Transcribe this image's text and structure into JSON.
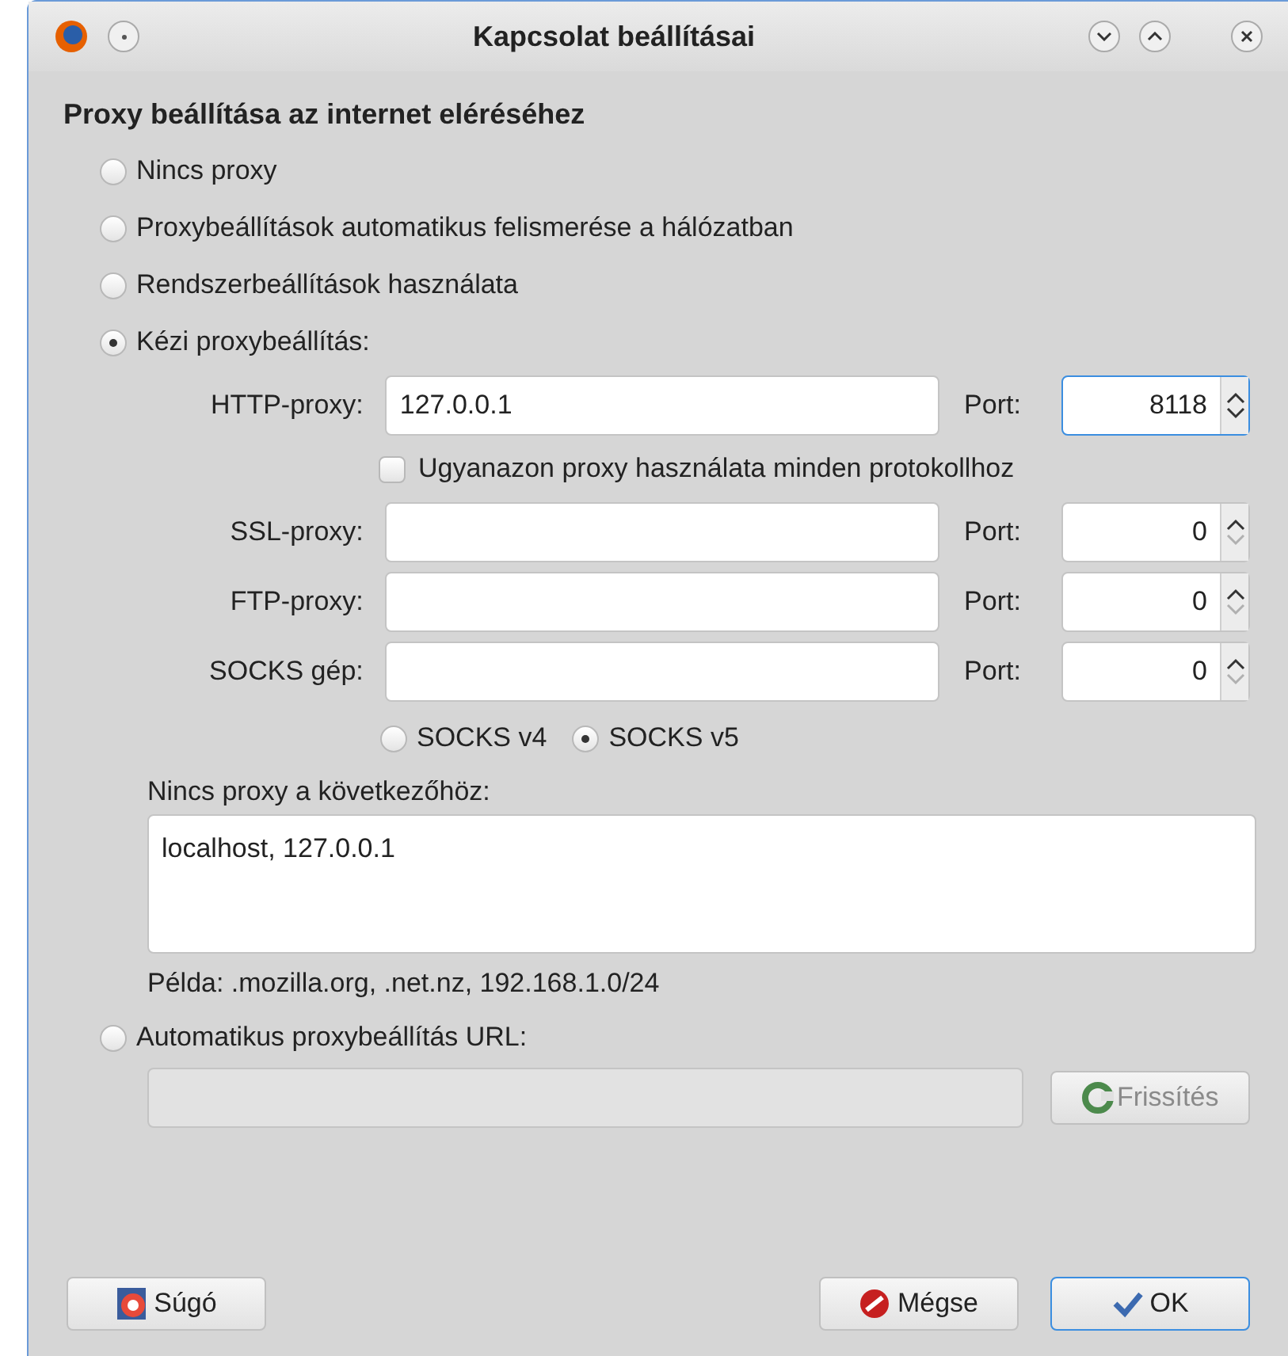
{
  "window": {
    "title": "Kapcsolat beállításai"
  },
  "heading": "Proxy beállítása az internet eléréséhez",
  "proxy_modes": [
    {
      "label": "Nincs proxy",
      "selected": false
    },
    {
      "label": "Proxybeállítások automatikus felismerése a hálózatban",
      "selected": false
    },
    {
      "label": "Rendszerbeállítások használata",
      "selected": false
    },
    {
      "label": "Kézi proxybeállítás:",
      "selected": true
    }
  ],
  "http": {
    "label": "HTTP-proxy:",
    "value": "127.0.0.1",
    "port_label": "Port:",
    "port": "8118",
    "focused": true,
    "at_minimum": false
  },
  "same_proxy": {
    "label": "Ugyanazon proxy használata minden protokollhoz",
    "checked": false
  },
  "other_rows": [
    {
      "label": "SSL-proxy:",
      "port_label": "Port:",
      "port": "0",
      "focused": false,
      "at_minimum": true
    },
    {
      "label": "FTP-proxy:",
      "port_label": "Port:",
      "port": "0",
      "focused": false,
      "at_minimum": true
    },
    {
      "label": "SOCKS gép:",
      "port_label": "Port:",
      "port": "0",
      "focused": false,
      "at_minimum": true
    }
  ],
  "socks_versions": [
    {
      "label": "SOCKS v4",
      "selected": false
    },
    {
      "label": "SOCKS v5",
      "selected": true
    }
  ],
  "no_proxy": {
    "label": "Nincs proxy a következőhöz:",
    "value": "localhost, 127.0.0.1",
    "example": "Példa: .mozilla.org, .net.nz, 192.168.1.0/24"
  },
  "auto_url": {
    "label": "Automatikus proxybeállítás URL:",
    "selected": false,
    "disabled": true,
    "reload_label": "Frissítés"
  },
  "buttons": [
    {
      "kind": "help",
      "label": "Súgó"
    },
    {
      "kind": "cancel",
      "label": "Mégse"
    },
    {
      "kind": "ok",
      "label": "OK"
    }
  ]
}
